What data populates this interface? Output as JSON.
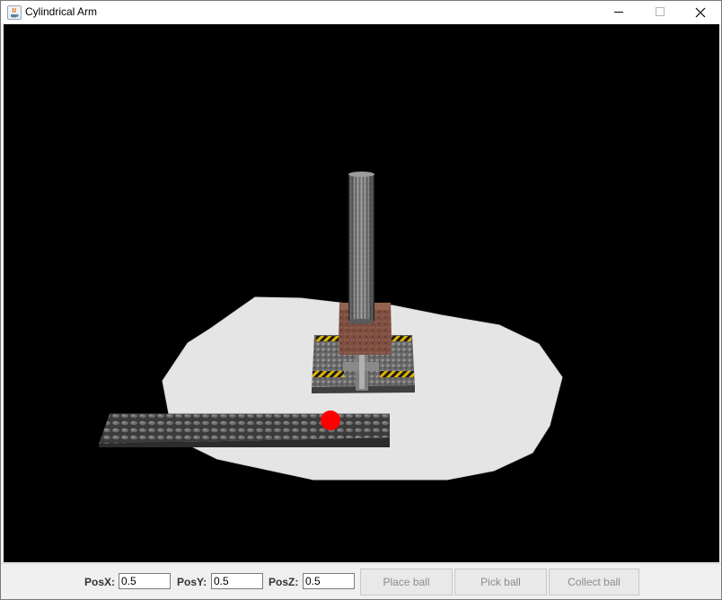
{
  "window": {
    "title": "Cylindrical Arm",
    "app_icon": "java-icon",
    "controls": [
      "minimize-icon",
      "maximize-icon",
      "close-icon"
    ]
  },
  "scene": {
    "background_color": "#000000",
    "floor_color": "#e5e5e5",
    "ball_color": "#ff0000"
  },
  "controls": {
    "posx_label": "PosX:",
    "posx_value": "0.5",
    "posy_label": "PosY:",
    "posy_value": "0.5",
    "posz_label": "PosZ:",
    "posz_value": "0.5",
    "place_ball_label": "Place ball",
    "pick_ball_label": "Pick ball",
    "collect_ball_label": "Collect ball"
  }
}
